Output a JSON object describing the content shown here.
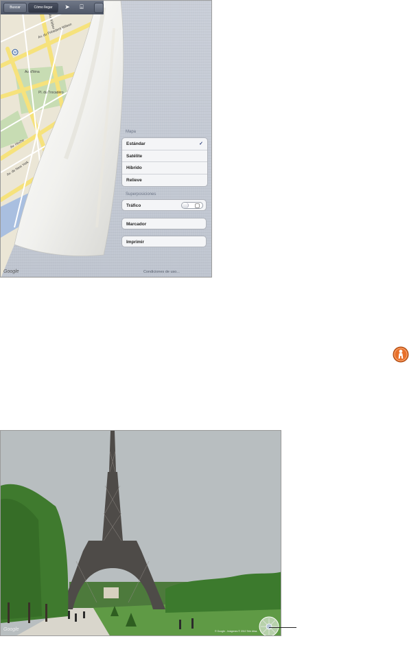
{
  "toolbar": {
    "buttons": [
      "Buscar",
      "Cómo llegar"
    ],
    "locate_icon": "location-arrow-icon",
    "bookmarks_icon": "bookmarks-book-icon"
  },
  "map": {
    "labels": [
      "Av. du Président Wilson",
      "Av. de New York",
      "Av. Kléber",
      "Av. d'Iéna",
      "Pl. du Trocadéro",
      "Av. Hoche"
    ],
    "attribution": "Google"
  },
  "options": {
    "map_section_title": "Mapa",
    "map_types": [
      {
        "label": "Estándar",
        "selected": true
      },
      {
        "label": "Satélite",
        "selected": false
      },
      {
        "label": "Híbrido",
        "selected": false
      },
      {
        "label": "Relieve",
        "selected": false
      }
    ],
    "overlays_section_title": "Superposiciones",
    "traffic_label": "Tráfico",
    "traffic_on": false,
    "bookmark_label": "Marcador",
    "print_label": "Imprimir",
    "terms_label": "Condiciones de uso..."
  },
  "street_view": {
    "attribution": "Google",
    "copyright": "© Google - Imágenes © 2010 Tele Atlas"
  },
  "colors": {
    "map_bg": "#ebe6d6",
    "park": "#c7dcb3",
    "road_major": "#f6e27c",
    "water": "#a9bfe0",
    "sky": "#b8bec0",
    "trees": "#3f7a2e",
    "pegman": "#e8702a"
  }
}
